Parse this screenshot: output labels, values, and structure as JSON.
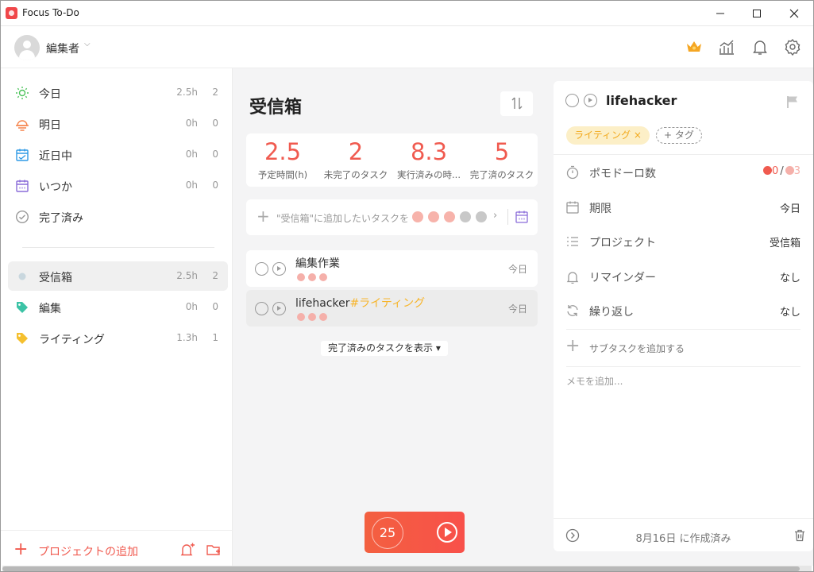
{
  "window": {
    "title": "Focus To-Do"
  },
  "header": {
    "user_name": "編集者"
  },
  "sidebar": {
    "items": [
      {
        "label": "今日",
        "time": "2.5h",
        "count": "2",
        "icon": "sun-icon",
        "color": "#4cc35b"
      },
      {
        "label": "明日",
        "time": "0h",
        "count": "0",
        "icon": "sunset-icon",
        "color": "#f5844c"
      },
      {
        "label": "近日中",
        "time": "0h",
        "count": "0",
        "icon": "calendar-week-icon",
        "color": "#2f9ae5"
      },
      {
        "label": "いつか",
        "time": "0h",
        "count": "0",
        "icon": "calendar-icon",
        "color": "#8a6cd9"
      },
      {
        "label": "完了済み",
        "icon": "check-circle-icon",
        "color": "#999999"
      }
    ],
    "projects": [
      {
        "label": "受信箱",
        "time": "2.5h",
        "count": "2",
        "icon": "dot-icon",
        "color": "#c9d7de"
      },
      {
        "label": "編集",
        "time": "0h",
        "count": "0",
        "icon": "tag-icon",
        "color": "#3cc3a6"
      },
      {
        "label": "ライティング",
        "time": "1.3h",
        "count": "1",
        "icon": "tag-icon",
        "color": "#f5c02f"
      }
    ],
    "add_project": "プロジェクトの追加"
  },
  "main": {
    "title": "受信箱",
    "stats": [
      {
        "value": "2.5",
        "label": "予定時間(h)"
      },
      {
        "value": "2",
        "label": "未完了のタスク"
      },
      {
        "value": "8.3",
        "label": "実行済みの時..."
      },
      {
        "value": "5",
        "label": "完了済のタスク"
      }
    ],
    "add_task_placeholder": "\"受信箱\"に追加したいタスクを",
    "tasks": [
      {
        "title": "編集作業",
        "tag": "",
        "date": "今日",
        "pomodoros": 3
      },
      {
        "title": "lifehacker",
        "tag": "#ライティング",
        "date": "今日",
        "pomodoros": 3
      }
    ],
    "show_completed": "完了済みのタスクを表示 ▾",
    "timer_value": "25"
  },
  "detail": {
    "title": "lifehacker",
    "tag": "ライティング ×",
    "add_tag": "+ タグ",
    "rows": [
      {
        "label": "ポモドーロ数",
        "value_done": "0",
        "value_sep": "/",
        "value_total": "3",
        "icon": "timer-icon"
      },
      {
        "label": "期限",
        "value": "今日",
        "icon": "calendar-icon"
      },
      {
        "label": "プロジェクト",
        "value": "受信箱",
        "icon": "list-icon"
      },
      {
        "label": "リマインダー",
        "value": "なし",
        "icon": "bell-icon"
      },
      {
        "label": "繰り返し",
        "value": "なし",
        "icon": "repeat-icon"
      }
    ],
    "add_subtask": "サブタスクを追加する",
    "memo_placeholder": "メモを追加...",
    "created": "8月16日 に作成済み"
  },
  "colors": {
    "accent": "#f05a4f",
    "tag_yellow": "#f7b52b"
  }
}
